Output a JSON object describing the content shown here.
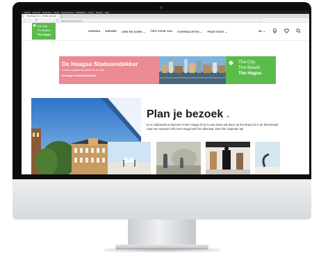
{
  "menubar": {
    "items": [
      "Firefox",
      "Bestand",
      "Bewerken",
      "Beeld",
      "Geschiedenis",
      "Bladwijzers",
      "Extra",
      "Venster",
      "Help"
    ]
  },
  "browser": {
    "tab_title": "Denhaag.com - Ontdek de stad",
    "tab_add": "+",
    "url": "https://denhaag.com/nl",
    "back": "‹",
    "forward": "›",
    "reload": "↻"
  },
  "site": {
    "logo_lines": [
      "The City",
      "The Beach",
      "The Hague."
    ],
    "nav": [
      "AGENDA",
      "NIEUWS",
      "ZIEN EN DOEN ⌄",
      "TIPS VOOR JOU",
      "OVERNACHTEN ⌄",
      "PRAKTISCH ⌄"
    ],
    "language": "NL ⌄",
    "icons": [
      "map-pin-icon",
      "heart-icon",
      "search-icon"
    ]
  },
  "banner": {
    "title": "De Haagse Stadsontdekker",
    "subtitle": "Ontdek verrassende plekken in de stad",
    "url": "denhaag.com/stadsontdekker",
    "green_lines": [
      "The City",
      "The Beach",
      "The Hague."
    ]
  },
  "hero": {
    "title": "Plan je bezoek",
    "title_dot": ".",
    "body": "Er is voldoende te beleven in Den Haag! Of je nu iets leuks wilt doen op het strand of in de binnenstad naar een museum wilt, Den Haag heeft het allemaal. Doe hier inspiratie op!"
  },
  "colors": {
    "brand_green": "#5bbc4c",
    "banner_pink": "#ea8a92",
    "text_dark": "#1a1a1a"
  }
}
